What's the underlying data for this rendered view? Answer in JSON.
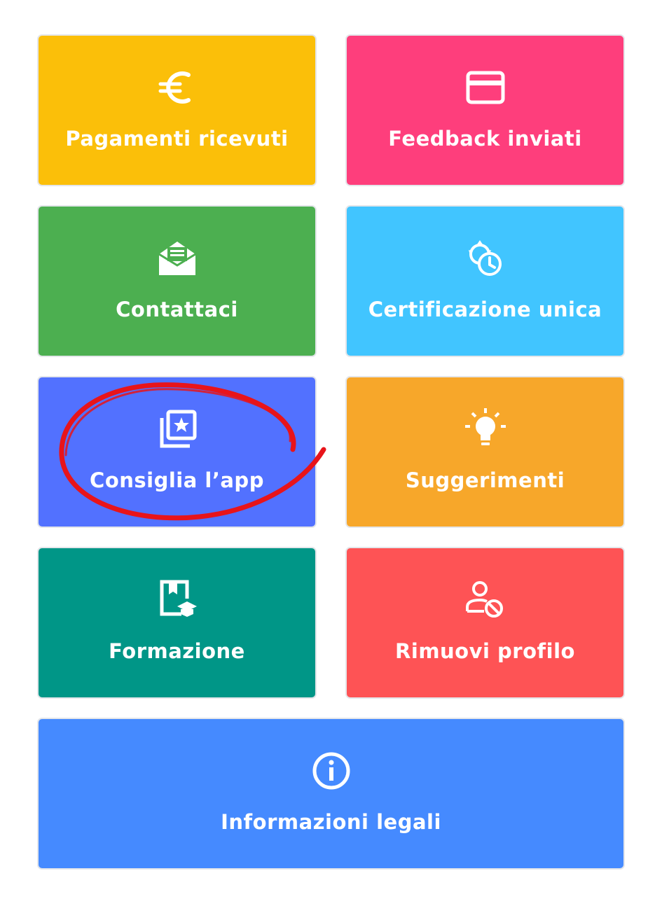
{
  "tiles": [
    {
      "label": "Pagamenti ricevuti",
      "icon": "euro-icon",
      "color": "#fbbf09"
    },
    {
      "label": "Feedback inviati",
      "icon": "card-icon",
      "color": "#fe3e7c"
    },
    {
      "label": "Contattaci",
      "icon": "envelope-open-icon",
      "color": "#4caf50"
    },
    {
      "label": "Certificazione unica",
      "icon": "clock-cycle-icon",
      "color": "#41c5ff"
    },
    {
      "label": "Consiglia l’app",
      "icon": "star-gallery-icon",
      "color": "#5271ff"
    },
    {
      "label": "Suggerimenti",
      "icon": "lightbulb-icon",
      "color": "#f7a72a"
    },
    {
      "label": "Formazione",
      "icon": "book-graduation-icon",
      "color": "#009687"
    },
    {
      "label": "Rimuovi profilo",
      "icon": "user-block-icon",
      "color": "#fe5355"
    },
    {
      "label": "Informazioni legali",
      "icon": "info-icon",
      "color": "#458aff"
    }
  ],
  "annotation": {
    "shape": "hand-drawn-ellipse",
    "color": "#e8141a",
    "target": "Consiglia l’app"
  }
}
